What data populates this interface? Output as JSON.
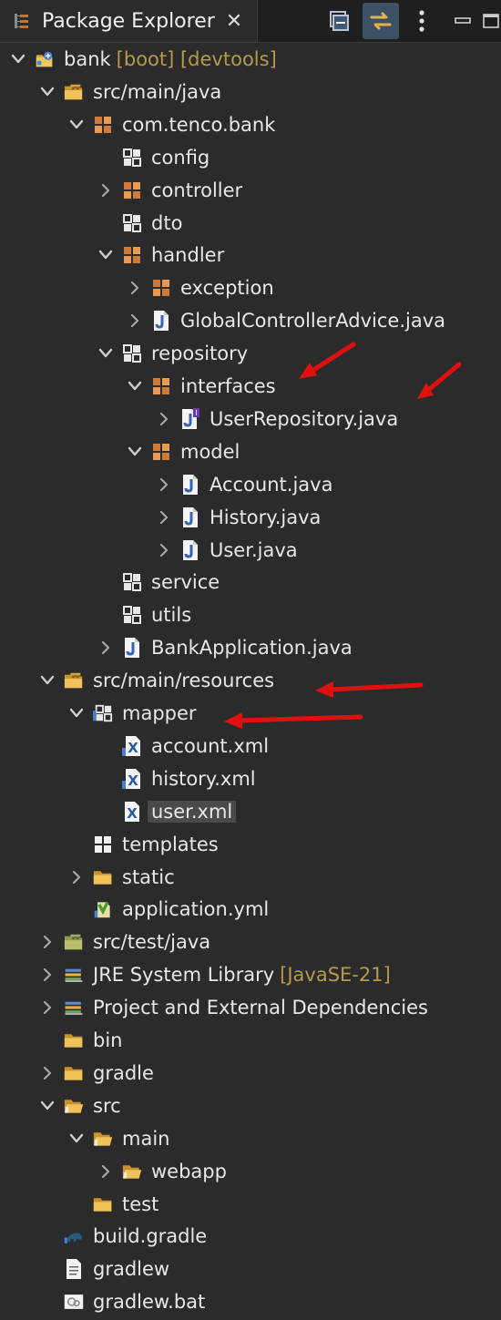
{
  "view": {
    "title": "Package Explorer",
    "close_glyph": "✕",
    "toolbar": [
      {
        "name": "collapse-all-icon",
        "active": false
      },
      {
        "name": "link-with-editor-icon",
        "active": true
      },
      {
        "name": "view-menu-icon",
        "active": false
      },
      {
        "name": "minimize-icon",
        "active": false
      },
      {
        "name": "maximize-icon",
        "active": false
      }
    ]
  },
  "tree": [
    {
      "label": "bank",
      "deco": "[boot] [devtools]",
      "depth": 0,
      "chevron": "down",
      "icon": "project"
    },
    {
      "label": "src/main/java",
      "depth": 1,
      "chevron": "down",
      "icon": "source-folder"
    },
    {
      "label": "com.tenco.bank",
      "depth": 2,
      "chevron": "down",
      "icon": "package"
    },
    {
      "label": "config",
      "depth": 3,
      "chevron": "none",
      "icon": "package-empty"
    },
    {
      "label": "controller",
      "depth": 3,
      "chevron": "right",
      "icon": "package"
    },
    {
      "label": "dto",
      "depth": 3,
      "chevron": "none",
      "icon": "package-empty"
    },
    {
      "label": "handler",
      "depth": 3,
      "chevron": "down",
      "icon": "package"
    },
    {
      "label": "exception",
      "depth": 4,
      "chevron": "right",
      "icon": "package"
    },
    {
      "label": "GlobalControllerAdvice.java",
      "depth": 4,
      "chevron": "right",
      "icon": "java-file"
    },
    {
      "label": "repository",
      "depth": 3,
      "chevron": "down",
      "icon": "package-empty"
    },
    {
      "label": "interfaces",
      "depth": 4,
      "chevron": "down",
      "icon": "package"
    },
    {
      "label": "UserRepository.java",
      "depth": 5,
      "chevron": "right",
      "icon": "java-interface"
    },
    {
      "label": "model",
      "depth": 4,
      "chevron": "down",
      "icon": "package"
    },
    {
      "label": "Account.java",
      "depth": 5,
      "chevron": "right",
      "icon": "java-file"
    },
    {
      "label": "History.java",
      "depth": 5,
      "chevron": "right",
      "icon": "java-file"
    },
    {
      "label": "User.java",
      "depth": 5,
      "chevron": "right",
      "icon": "java-file"
    },
    {
      "label": "service",
      "depth": 3,
      "chevron": "none",
      "icon": "package-empty"
    },
    {
      "label": "utils",
      "depth": 3,
      "chevron": "none",
      "icon": "package-empty"
    },
    {
      "label": "BankApplication.java",
      "depth": 3,
      "chevron": "right",
      "icon": "java-file"
    },
    {
      "label": "src/main/resources",
      "depth": 1,
      "chevron": "down",
      "icon": "source-folder"
    },
    {
      "label": "mapper",
      "depth": 2,
      "chevron": "down",
      "icon": "package-empty-xml"
    },
    {
      "label": "account.xml",
      "depth": 3,
      "chevron": "none",
      "icon": "xml-file-linked"
    },
    {
      "label": "history.xml",
      "depth": 3,
      "chevron": "none",
      "icon": "xml-file-linked"
    },
    {
      "label": "user.xml",
      "depth": 3,
      "chevron": "none",
      "icon": "xml-file",
      "selected": true
    },
    {
      "label": "templates",
      "depth": 2,
      "chevron": "none",
      "icon": "package-white"
    },
    {
      "label": "static",
      "depth": 2,
      "chevron": "right",
      "icon": "folder"
    },
    {
      "label": "application.yml",
      "depth": 2,
      "chevron": "none",
      "icon": "yaml-file"
    },
    {
      "label": "src/test/java",
      "depth": 1,
      "chevron": "right",
      "icon": "source-folder-test"
    },
    {
      "label": "JRE System Library",
      "deco": "[JavaSE-21]",
      "depth": 1,
      "chevron": "right",
      "icon": "library"
    },
    {
      "label": "Project and External Dependencies",
      "depth": 1,
      "chevron": "right",
      "icon": "library"
    },
    {
      "label": "bin",
      "depth": 1,
      "chevron": "none",
      "icon": "folder"
    },
    {
      "label": "gradle",
      "depth": 1,
      "chevron": "right",
      "icon": "folder"
    },
    {
      "label": "src",
      "depth": 1,
      "chevron": "down",
      "icon": "folder-open"
    },
    {
      "label": "main",
      "depth": 2,
      "chevron": "down",
      "icon": "folder-open"
    },
    {
      "label": "webapp",
      "depth": 3,
      "chevron": "right",
      "icon": "folder-open"
    },
    {
      "label": "test",
      "depth": 2,
      "chevron": "none",
      "icon": "folder"
    },
    {
      "label": "build.gradle",
      "depth": 1,
      "chevron": "none",
      "icon": "gradle-file"
    },
    {
      "label": "gradlew",
      "depth": 1,
      "chevron": "none",
      "icon": "text-file"
    },
    {
      "label": "gradlew.bat",
      "depth": 1,
      "chevron": "none",
      "icon": "bat-file"
    }
  ],
  "annotations": {
    "arrow_color": "#e01010"
  }
}
